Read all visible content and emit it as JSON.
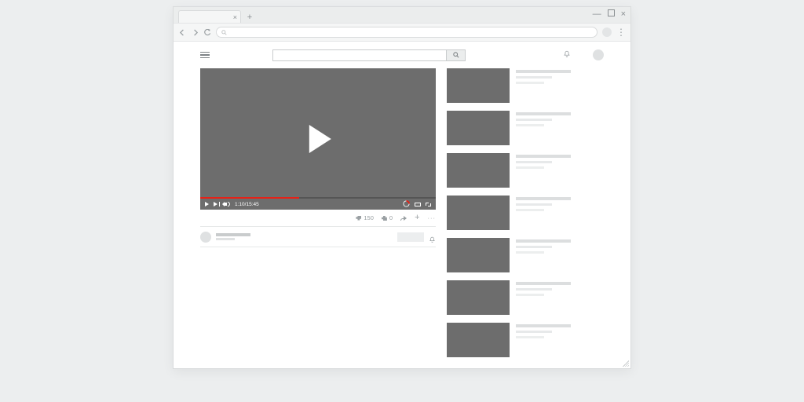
{
  "browser": {
    "tab_close_glyph": "×",
    "newtab_glyph": "+",
    "win_min_glyph": "—",
    "win_close_glyph": "×",
    "url_value": ""
  },
  "player": {
    "time_display": "1:10/15:45",
    "progress_pct": 42
  },
  "actions": {
    "likes": "150",
    "dislikes": "0",
    "plus_glyph": "+",
    "more_glyph": "···"
  },
  "sidebar": {
    "item_count": 7
  }
}
